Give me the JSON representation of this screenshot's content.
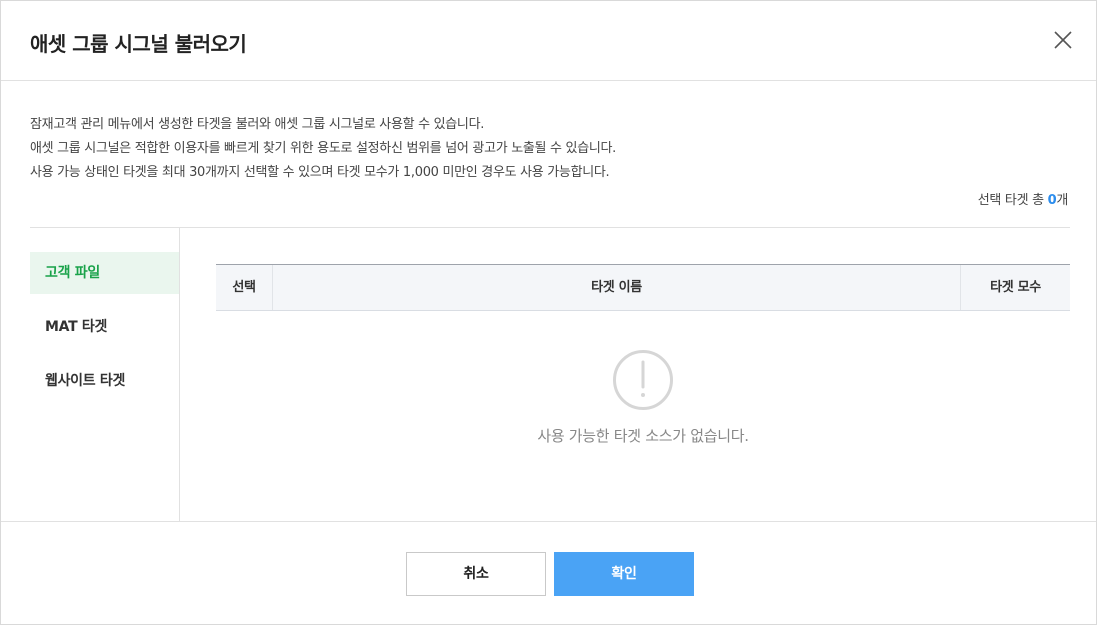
{
  "dialog": {
    "title": "애셋 그룹 시그널 불러오기",
    "close_icon": "close-icon"
  },
  "description": {
    "line1": "잠재고객 관리 메뉴에서 생성한 타겟을 불러와 애셋 그룹 시그널로 사용할 수 있습니다.",
    "line2": "애셋 그룹 시그널은 적합한 이용자를 빠르게 찾기 위한 용도로 설정하신 범위를 넘어 광고가 노출될 수 있습니다.",
    "line3": "사용 가능 상태인 타겟을 최대 30개까지 선택할 수 있으며 타겟 모수가 1,000 미만인 경우도 사용 가능합니다."
  },
  "selection": {
    "prefix": "선택 타겟 총 ",
    "count": "0",
    "suffix": "개",
    "count_color": "#2c8ded"
  },
  "sidebar": {
    "items": [
      {
        "label": "고객 파일",
        "active": true
      },
      {
        "label": "MAT 타겟",
        "active": false
      },
      {
        "label": "웹사이트 타겟",
        "active": false
      }
    ],
    "active_color": "#1aa34a"
  },
  "table": {
    "columns": [
      "선택",
      "타겟 이름",
      "타겟 모수"
    ],
    "rows": []
  },
  "empty_state": {
    "icon": "exclamation-circle-icon",
    "message": "사용 가능한 타겟 소스가 없습니다."
  },
  "footer": {
    "cancel_label": "취소",
    "confirm_label": "확인",
    "confirm_color": "#4aa3f5"
  }
}
